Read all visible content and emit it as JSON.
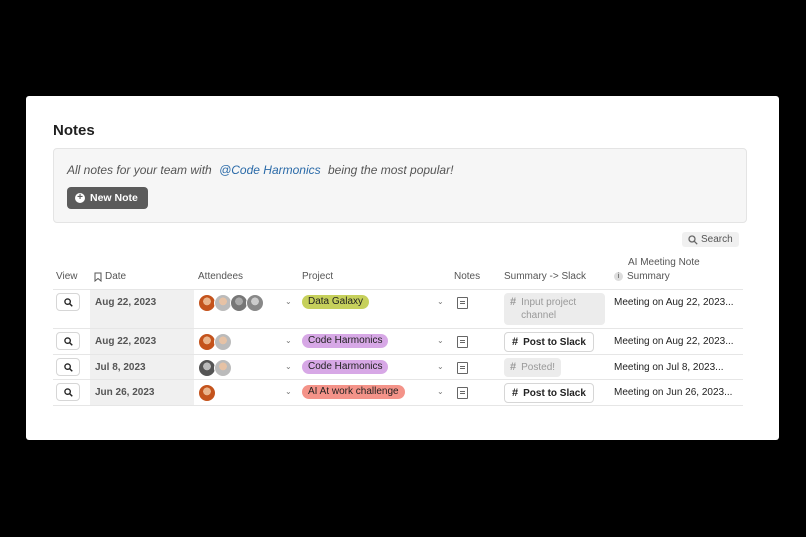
{
  "page": {
    "title": "Notes"
  },
  "banner": {
    "text_before": "All notes for your team with",
    "mention": "@Code Harmonics",
    "text_after": "being the most popular!",
    "new_note_label": "New Note"
  },
  "search": {
    "label": "Search"
  },
  "columns": {
    "view": "View",
    "date": "Date",
    "attendees": "Attendees",
    "project": "Project",
    "notes": "Notes",
    "summary_slack": "Summary -> Slack",
    "ai_note_line1": "AI Meeting Note",
    "ai_note_line2": "Summary"
  },
  "colors": {
    "data_galaxy": "#c6d05b",
    "code_harmonics": "#d7a8e6",
    "ai_work": "#f49389"
  },
  "rows": [
    {
      "date": "Aug 22, 2023",
      "attendees": [
        "orange-avatar",
        "gray-avatar",
        "gray-avatar",
        "gray-avatar"
      ],
      "project": "Data Galaxy",
      "slack_state": "Input project channel",
      "summary": "Meeting on Aug 22, 2023..."
    },
    {
      "date": "Aug 22, 2023",
      "attendees": [
        "orange-avatar",
        "gray-avatar"
      ],
      "project": "Code Harmonics",
      "slack_state": "Post to Slack",
      "summary": "Meeting on Aug 22, 2023..."
    },
    {
      "date": "Jul 8, 2023",
      "attendees": [
        "gray-avatar",
        "gray-avatar"
      ],
      "project": "Code Harmonics",
      "slack_state": "Posted!",
      "summary": "Meeting on Jul 8, 2023..."
    },
    {
      "date": "Jun 26, 2023",
      "attendees": [
        "orange-avatar"
      ],
      "project": "AI At work challenge",
      "slack_state": "Post to Slack",
      "summary": "Meeting on Jun 26, 2023..."
    }
  ]
}
